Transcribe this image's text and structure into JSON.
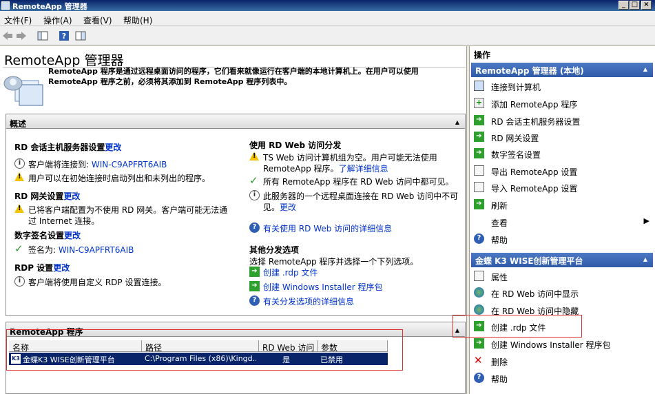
{
  "window": {
    "title": "RemoteApp 管理器"
  },
  "menu": [
    "文件(F)",
    "操作(A)",
    "查看(V)",
    "帮助(H)"
  ],
  "page": {
    "title": "RemoteApp 管理器",
    "description": "RemoteApp 程序是通过远程桌面访问的程序，它们看来就像运行在客户端的本地计算机上。在用户可以使用 RemoteApp 程序之前，必须将其添加到 RemoteApp 程序列表中。"
  },
  "overview": {
    "header": "概述",
    "left": {
      "rdsh": {
        "title": "RD 会话主机服务器设置",
        "change": "更改",
        "items": [
          {
            "icon": "info",
            "text": "客户端将连接到: ",
            "link": "WIN-C9APFRT6AIB"
          },
          {
            "icon": "warning",
            "text": "用户可以在初始连接时启动列出和未列出的程序。"
          }
        ]
      },
      "gateway": {
        "title": "RD 网关设置",
        "change": "更改",
        "items": [
          {
            "icon": "warning",
            "line1": "已将客户端配置为不使用 RD 网关。客户端可能无法通",
            "line2": "过 Internet 连接。"
          }
        ]
      },
      "signing": {
        "title": "数字签名设置",
        "change": "更改",
        "items": [
          {
            "icon": "check",
            "text": "签名为: ",
            "link": "WIN-C9APFRT6AIB"
          }
        ]
      },
      "rdp": {
        "title": "RDP 设置",
        "change": "更改",
        "items": [
          {
            "icon": "info",
            "text": "客户端将使用自定义 RDP 设置连接。"
          }
        ]
      }
    },
    "right": {
      "web": {
        "title": "使用 RD Web 访问分发",
        "items": [
          {
            "icon": "warning",
            "line1": "TS Web 访问计算机组为空。用户可能无法使用",
            "line2": "RemoteApp 程序。",
            "link": "了解详细信息"
          },
          {
            "icon": "check",
            "text": "所有 RemoteApp 程序在 RD Web 访问中都可见。"
          },
          {
            "icon": "info",
            "line1": "此服务器的一个远程桌面连接在 RD Web 访问中不可",
            "line2": "见。",
            "link": "更改"
          }
        ],
        "more": "有关使用 RD Web 访问的详细信息"
      },
      "other": {
        "title": "其他分发选项",
        "desc": "选择 RemoteApp 程序并选择一个下列选项。",
        "links": [
          "创建 .rdp 文件",
          "创建 Windows Installer 程序包",
          "有关分发选项的详细信息"
        ]
      }
    }
  },
  "programs": {
    "header": "RemoteApp 程序",
    "columns": [
      "名称",
      "路径",
      "RD Web 访问",
      "参数"
    ],
    "rows": [
      {
        "name": "金蝶K3 WISE创新管理平台",
        "path": "C:\\Program Files (x86)\\Kingd...",
        "web": "是",
        "args": "已禁用"
      }
    ]
  },
  "actions": {
    "title": "操作",
    "group1": {
      "header": "RemoteApp 管理器 (本地)",
      "items": [
        {
          "icon": "computer-icon",
          "label": "连接到计算机"
        },
        {
          "icon": "add-icon",
          "label": "添加 RemoteApp 程序"
        },
        {
          "icon": "go-icon",
          "label": "RD 会话主机服务器设置"
        },
        {
          "icon": "go-icon",
          "label": "RD 网关设置"
        },
        {
          "icon": "go-icon",
          "label": "数字签名设置"
        },
        {
          "icon": "export-icon",
          "label": "导出 RemoteApp 设置"
        },
        {
          "icon": "import-icon",
          "label": "导入 RemoteApp 设置"
        },
        {
          "icon": "refresh-icon",
          "label": "刷新"
        },
        {
          "icon": "none",
          "label": "查看"
        },
        {
          "icon": "help-icon",
          "label": "帮助"
        }
      ]
    },
    "group2": {
      "header": "金蝶 K3 WISE创新管理平台",
      "items": [
        {
          "icon": "properties-icon",
          "label": "属性"
        },
        {
          "icon": "globe-icon",
          "label": "在 RD Web 访问中显示"
        },
        {
          "icon": "globe-icon",
          "label": "在 RD Web 访问中隐藏"
        },
        {
          "icon": "go-icon",
          "label": "创建 .rdp 文件"
        },
        {
          "icon": "go-icon",
          "label": "创建 Windows Installer 程序包"
        },
        {
          "icon": "delete-icon",
          "label": "删除"
        },
        {
          "icon": "help-icon",
          "label": "帮助"
        }
      ]
    }
  }
}
